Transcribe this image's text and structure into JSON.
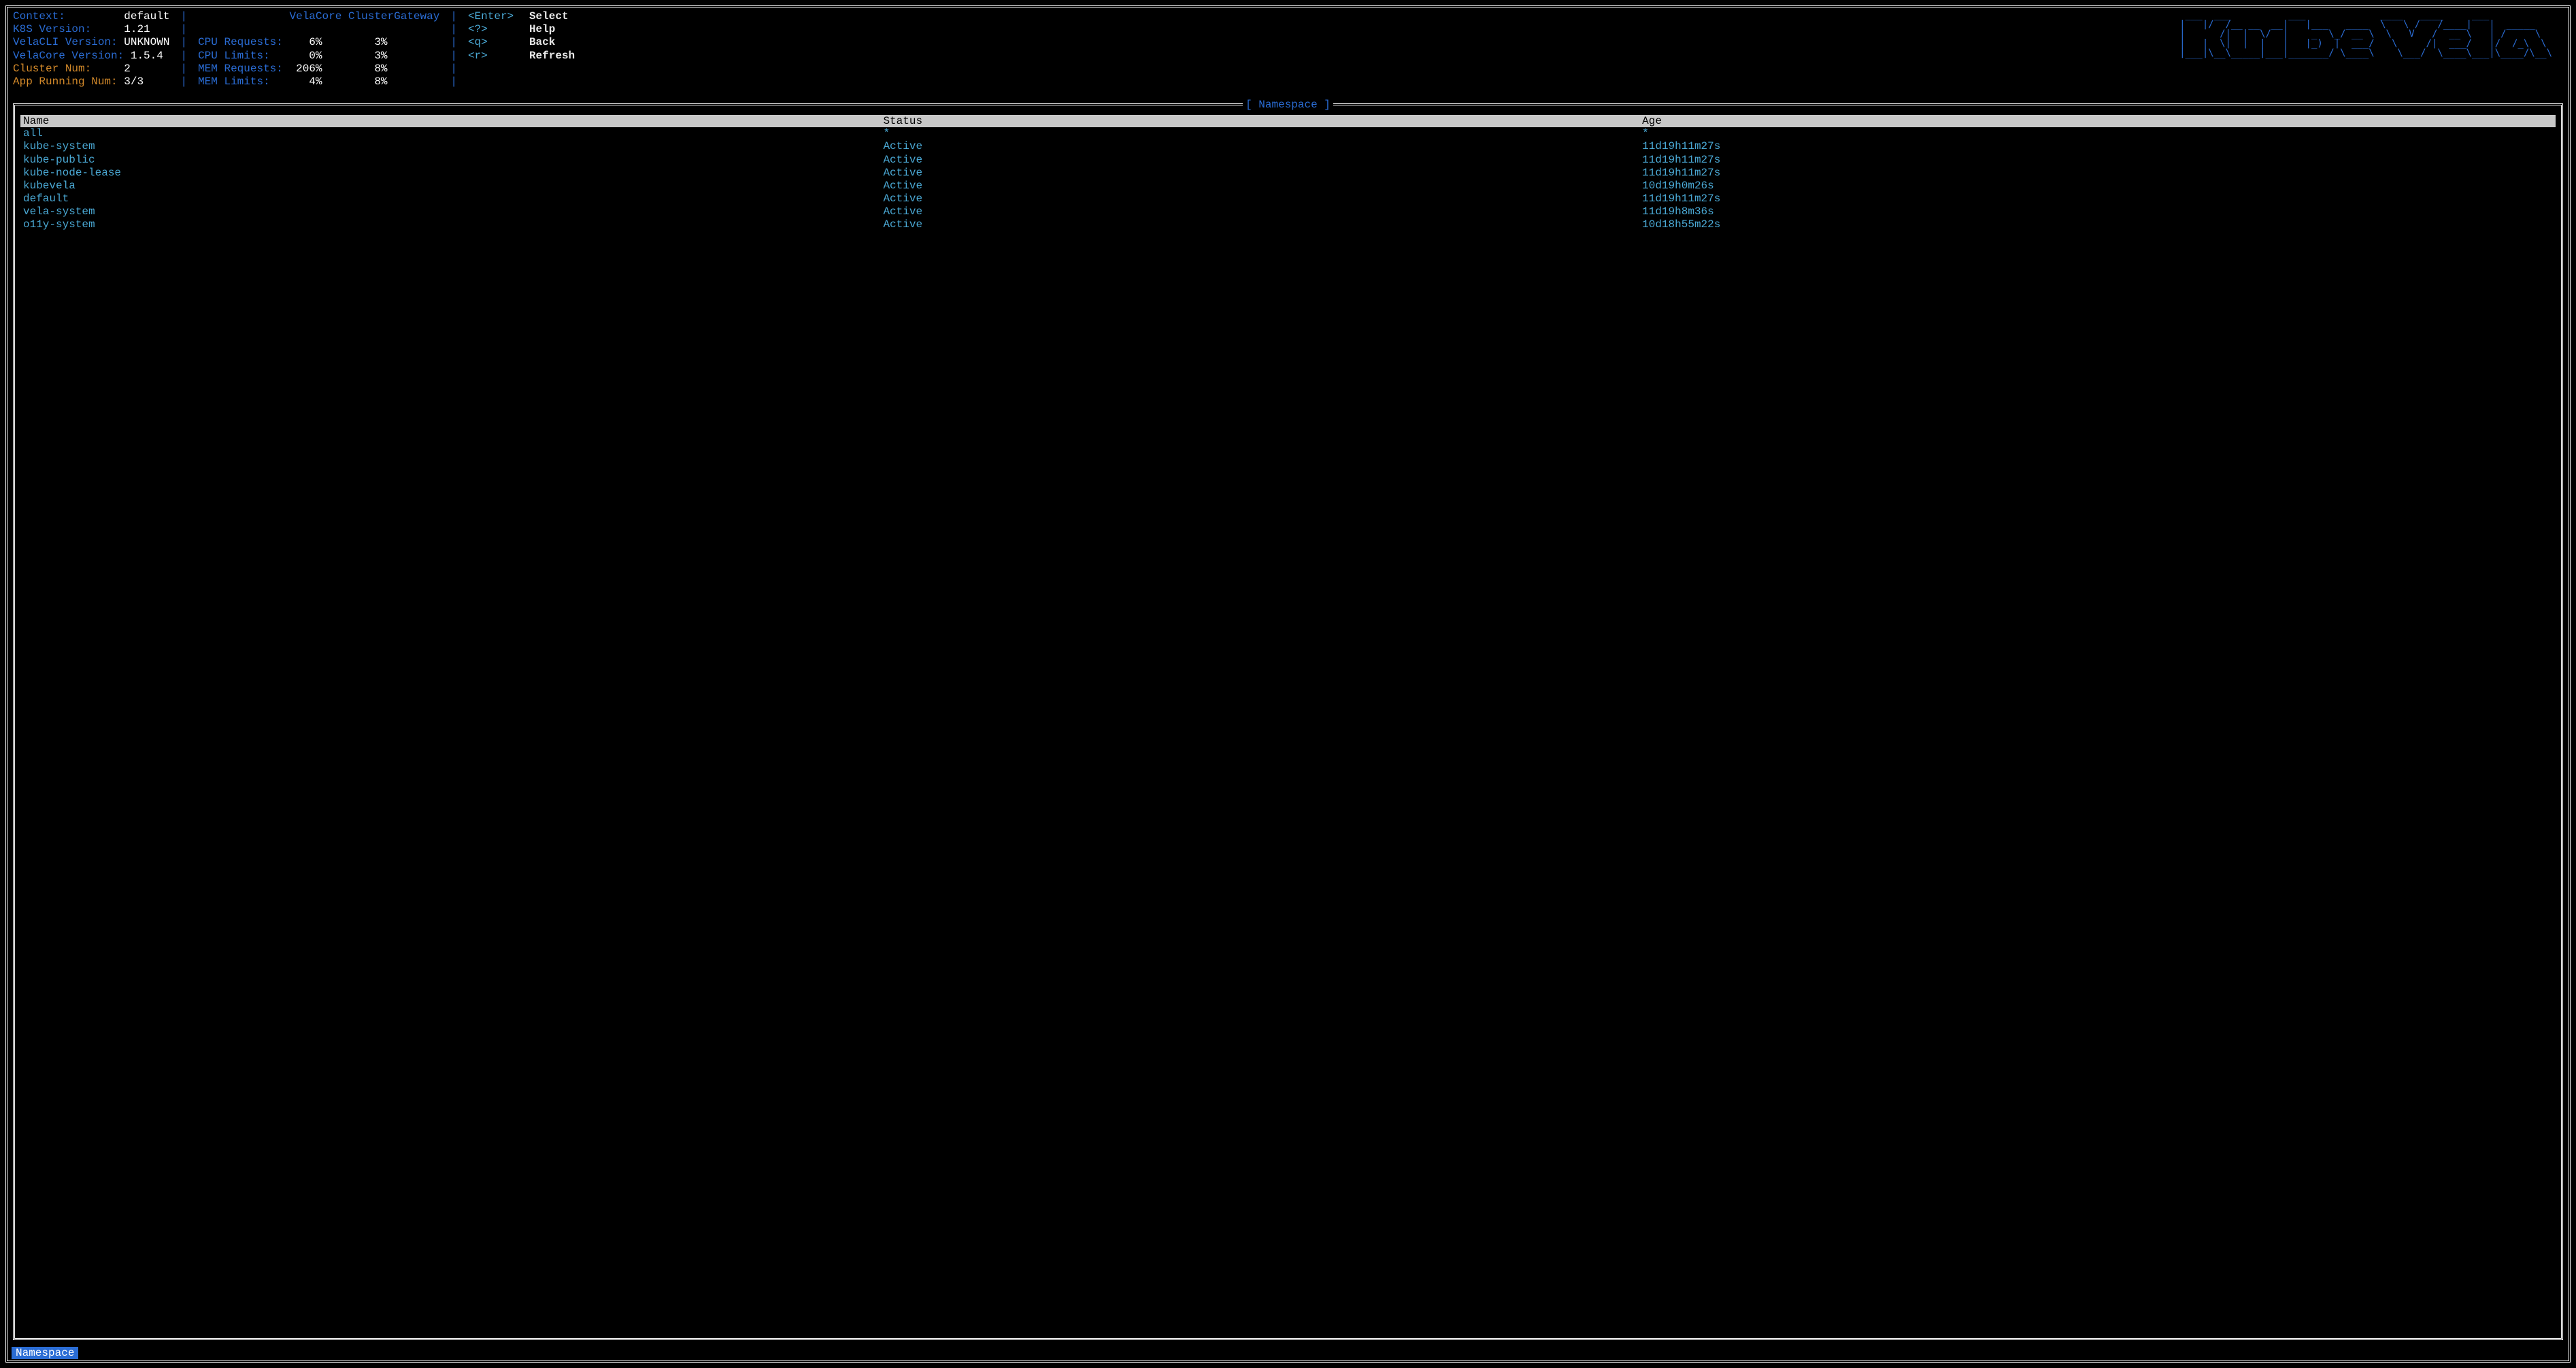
{
  "header": {
    "info": {
      "context_label": "Context:",
      "context_value": "default",
      "k8s_label": "K8S Version:",
      "k8s_value": "1.21",
      "velacli_label": "VelaCLI Version:",
      "velacli_value": "UNKNOWN",
      "velacore_label": "VelaCore Version:",
      "velacore_value": "1.5.4",
      "cluster_label": "Cluster Num:",
      "cluster_value": "2",
      "apprun_label": "App Running Num:",
      "apprun_value": "3/3"
    },
    "resources": {
      "col1_header": "VelaCore",
      "col2_header": "ClusterGateway",
      "cpu_req_label": "CPU Requests:",
      "cpu_req_v1": "6%",
      "cpu_req_v2": "3%",
      "cpu_lim_label": "CPU Limits:",
      "cpu_lim_v1": "0%",
      "cpu_lim_v2": "3%",
      "mem_req_label": "MEM Requests:",
      "mem_req_v1": "206%",
      "mem_req_v2": "8%",
      "mem_lim_label": "MEM Limits:",
      "mem_lim_v1": "4%",
      "mem_lim_v2": "8%"
    },
    "keys": {
      "enter_key": "<Enter>",
      "enter_action": "Select",
      "help_key": "<?>",
      "help_action": "Help",
      "back_key": "<q>",
      "back_action": "Back",
      "refresh_key": "<r>",
      "refresh_action": "Refresh"
    },
    "logo": " ___  ___          ___             ____   ____     ___\n|   |/  /__ __  __|   |___   ____  \\   \\ /   /____|   |  _____\n|      /|  |  \\/  |    _  \\_/ __ \\  \\   V   /  __ \\   | /     \\\n|   |  \\|  |  |   |   |_)  |  ___/   \\     /|  ___/   |/  /_\\  \\\n|___|\\__\\_____|___|_______/ \\____\\    \\___/  \\____\\___|\\____/\\__\\"
  },
  "panel": {
    "title": "[ Namespace ]",
    "columns": {
      "name": "Name",
      "status": "Status",
      "age": "Age"
    },
    "rows": [
      {
        "name": "all",
        "status": "*",
        "age": "*"
      },
      {
        "name": "kube-system",
        "status": "Active",
        "age": "11d19h11m27s"
      },
      {
        "name": "kube-public",
        "status": "Active",
        "age": "11d19h11m27s"
      },
      {
        "name": "kube-node-lease",
        "status": "Active",
        "age": "11d19h11m27s"
      },
      {
        "name": "kubevela",
        "status": "Active",
        "age": "10d19h0m26s"
      },
      {
        "name": "default",
        "status": "Active",
        "age": "11d19h11m27s"
      },
      {
        "name": "vela-system",
        "status": "Active",
        "age": "11d19h8m36s"
      },
      {
        "name": "o11y-system",
        "status": "Active",
        "age": "10d18h55m22s"
      }
    ]
  },
  "footer": {
    "breadcrumb": "Namespace"
  }
}
